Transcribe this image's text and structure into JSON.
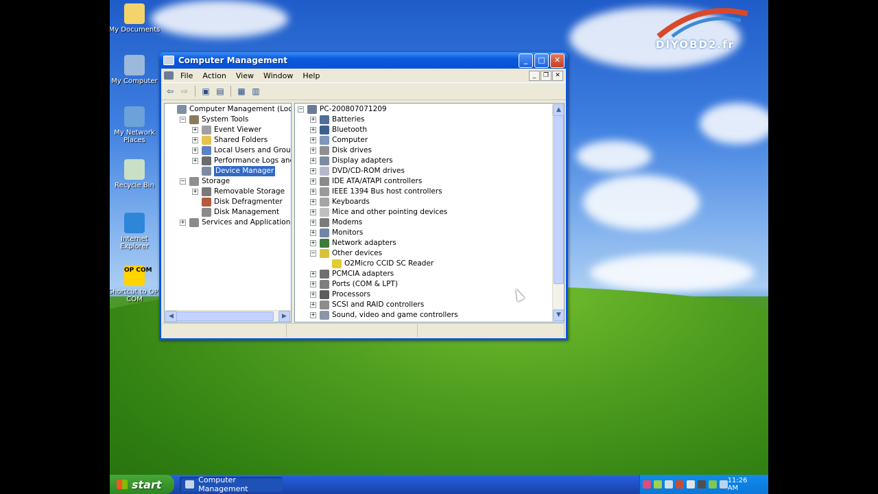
{
  "desktop": {
    "icons": [
      {
        "label": "My Documents",
        "color": "#f5d36b"
      },
      {
        "label": "My Computer",
        "color": "#9cb8da"
      },
      {
        "label": "My Network Places",
        "color": "#6aa2d9"
      },
      {
        "label": "Recycle Bin",
        "color": "#c9e0c7"
      },
      {
        "label": "Internet Explorer",
        "color": "#2f86d9"
      },
      {
        "label": "Shortcut to OP-COM",
        "color": "#ffd400",
        "badge": "OP COM"
      }
    ],
    "watermark": "DIYOBD2.fr"
  },
  "window": {
    "title": "Computer Management",
    "menu": [
      "File",
      "Action",
      "View",
      "Window",
      "Help"
    ],
    "left_tree": [
      {
        "label": "Computer Management (Local)",
        "indent": 0,
        "toggle": "",
        "icon": "#7f8ea5"
      },
      {
        "label": "System Tools",
        "indent": 1,
        "toggle": "-",
        "icon": "#8a7a5e"
      },
      {
        "label": "Event Viewer",
        "indent": 2,
        "toggle": "+",
        "icon": "#a0a0a0"
      },
      {
        "label": "Shared Folders",
        "indent": 2,
        "toggle": "+",
        "icon": "#e7c24d"
      },
      {
        "label": "Local Users and Groups",
        "indent": 2,
        "toggle": "+",
        "icon": "#5b82c7"
      },
      {
        "label": "Performance Logs and Alerts",
        "indent": 2,
        "toggle": "+",
        "icon": "#6b6b6b"
      },
      {
        "label": "Device Manager",
        "indent": 2,
        "toggle": "",
        "icon": "#7c8ca0",
        "selected": true
      },
      {
        "label": "Storage",
        "indent": 1,
        "toggle": "-",
        "icon": "#8e8e8e"
      },
      {
        "label": "Removable Storage",
        "indent": 2,
        "toggle": "+",
        "icon": "#7a7a7a"
      },
      {
        "label": "Disk Defragmenter",
        "indent": 2,
        "toggle": "",
        "icon": "#b25a3c"
      },
      {
        "label": "Disk Management",
        "indent": 2,
        "toggle": "",
        "icon": "#8a8a8a"
      },
      {
        "label": "Services and Applications",
        "indent": 1,
        "toggle": "+",
        "icon": "#8a8a8a"
      }
    ],
    "right_tree": [
      {
        "label": "PC-200807071209",
        "indent": 0,
        "toggle": "-",
        "icon": "#6a7b95"
      },
      {
        "label": "Batteries",
        "indent": 1,
        "toggle": "+",
        "icon": "#4f6e98"
      },
      {
        "label": "Bluetooth",
        "indent": 1,
        "toggle": "+",
        "icon": "#3d5f8f"
      },
      {
        "label": "Computer",
        "indent": 1,
        "toggle": "+",
        "icon": "#7d97bd"
      },
      {
        "label": "Disk drives",
        "indent": 1,
        "toggle": "+",
        "icon": "#8f8f8f"
      },
      {
        "label": "Display adapters",
        "indent": 1,
        "toggle": "+",
        "icon": "#7c8ca0"
      },
      {
        "label": "DVD/CD-ROM drives",
        "indent": 1,
        "toggle": "+",
        "icon": "#b7b7c9"
      },
      {
        "label": "IDE ATA/ATAPI controllers",
        "indent": 1,
        "toggle": "+",
        "icon": "#8a8a8a"
      },
      {
        "label": "IEEE 1394 Bus host controllers",
        "indent": 1,
        "toggle": "+",
        "icon": "#9a9a9a"
      },
      {
        "label": "Keyboards",
        "indent": 1,
        "toggle": "+",
        "icon": "#a5a5a5"
      },
      {
        "label": "Mice and other pointing devices",
        "indent": 1,
        "toggle": "+",
        "icon": "#c0c0c0"
      },
      {
        "label": "Modems",
        "indent": 1,
        "toggle": "+",
        "icon": "#7b7b7b"
      },
      {
        "label": "Monitors",
        "indent": 1,
        "toggle": "+",
        "icon": "#6f86a8"
      },
      {
        "label": "Network adapters",
        "indent": 1,
        "toggle": "+",
        "icon": "#3f7a3a"
      },
      {
        "label": "Other devices",
        "indent": 1,
        "toggle": "-",
        "icon": "#d8c23a"
      },
      {
        "label": "O2Micro CCID SC Reader",
        "indent": 2,
        "toggle": "",
        "icon": "#e0cc35"
      },
      {
        "label": "PCMCIA adapters",
        "indent": 1,
        "toggle": "+",
        "icon": "#707070"
      },
      {
        "label": "Ports (COM & LPT)",
        "indent": 1,
        "toggle": "+",
        "icon": "#7f7f7f"
      },
      {
        "label": "Processors",
        "indent": 1,
        "toggle": "+",
        "icon": "#5c5c5c"
      },
      {
        "label": "SCSI and RAID controllers",
        "indent": 1,
        "toggle": "+",
        "icon": "#8c8c8c"
      },
      {
        "label": "Sound, video and game controllers",
        "indent": 1,
        "toggle": "+",
        "icon": "#8a96a8"
      }
    ]
  },
  "taskbar": {
    "start_label": "start",
    "task_label": "Computer Management",
    "clock": "11:26 AM"
  }
}
